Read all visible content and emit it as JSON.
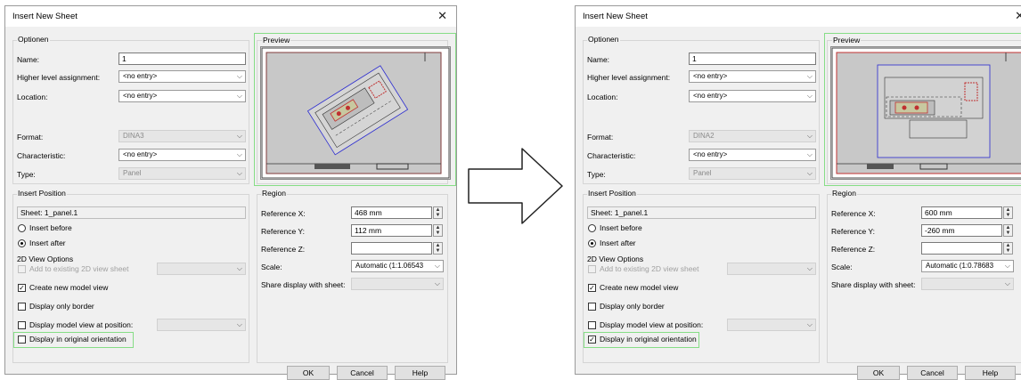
{
  "left_dialog": {
    "title": "Insert New Sheet",
    "close_glyph": "✕",
    "optionen": {
      "group_title": "Optionen",
      "name_label": "Name:",
      "name_value": "1",
      "higher_label": "Higher level assignment:",
      "higher_value": "<no entry>",
      "location_label": "Location:",
      "location_value": "<no entry>",
      "format_label": "Format:",
      "format_value": "DINA3",
      "characteristic_label": "Characteristic:",
      "characteristic_value": "<no entry>",
      "type_label": "Type:",
      "type_value": "Panel"
    },
    "preview": {
      "group_title": "Preview"
    },
    "insert_position": {
      "group_title": "Insert Position",
      "sheet_value": "Sheet: 1_panel.1",
      "insert_before": "Insert before",
      "insert_after": "Insert after"
    },
    "view_options": {
      "group_title": "2D View Options",
      "add_existing": "Add to existing 2D view sheet",
      "create_model": "Create new model view",
      "display_border": "Display only border",
      "display_position": "Display model view at position:",
      "original_orientation": "Display in original orientation",
      "create_model_checked": "✓",
      "original_orientation_checked": ""
    },
    "region": {
      "group_title": "Region",
      "ref_x_label": "Reference X:",
      "ref_x_value": "468 mm",
      "ref_y_label": "Reference Y:",
      "ref_y_value": "112 mm",
      "ref_z_label": "Reference Z:",
      "ref_z_value": "",
      "scale_label": "Scale:",
      "scale_value": "Automatic   (1:1.06543",
      "share_label": "Share display with sheet:"
    },
    "buttons": {
      "ok": "OK",
      "cancel": "Cancel",
      "help": "Help"
    }
  },
  "right_dialog": {
    "title": "Insert New Sheet",
    "close_glyph": "✕",
    "optionen": {
      "group_title": "Optionen",
      "name_label": "Name:",
      "name_value": "1",
      "higher_label": "Higher level assignment:",
      "higher_value": "<no entry>",
      "location_label": "Location:",
      "location_value": "<no entry>",
      "format_label": "Format:",
      "format_value": "DINA2",
      "characteristic_label": "Characteristic:",
      "characteristic_value": "<no entry>",
      "type_label": "Type:",
      "type_value": "Panel"
    },
    "preview": {
      "group_title": "Preview"
    },
    "insert_position": {
      "group_title": "Insert Position",
      "sheet_value": "Sheet: 1_panel.1",
      "insert_before": "Insert before",
      "insert_after": "Insert after"
    },
    "view_options": {
      "group_title": "2D View Options",
      "add_existing": "Add to existing 2D view sheet",
      "create_model": "Create new model view",
      "display_border": "Display only border",
      "display_position": "Display model view at position:",
      "original_orientation": "Display in original orientation",
      "create_model_checked": "✓",
      "original_orientation_checked": "✓"
    },
    "region": {
      "group_title": "Region",
      "ref_x_label": "Reference X:",
      "ref_x_value": "600 mm",
      "ref_y_label": "Reference Y:",
      "ref_y_value": "-260 mm",
      "ref_z_label": "Reference Z:",
      "ref_z_value": "",
      "scale_label": "Scale:",
      "scale_value": "Automatic   (1:0.78683",
      "share_label": "Share display with sheet:"
    },
    "buttons": {
      "ok": "OK",
      "cancel": "Cancel",
      "help": "Help"
    }
  },
  "colors": {
    "highlight": "#86dd86",
    "drawing_red": "#c03030",
    "drawing_blue": "#2a2ad0"
  },
  "icons": {
    "arrow": "right-arrow-icon"
  }
}
